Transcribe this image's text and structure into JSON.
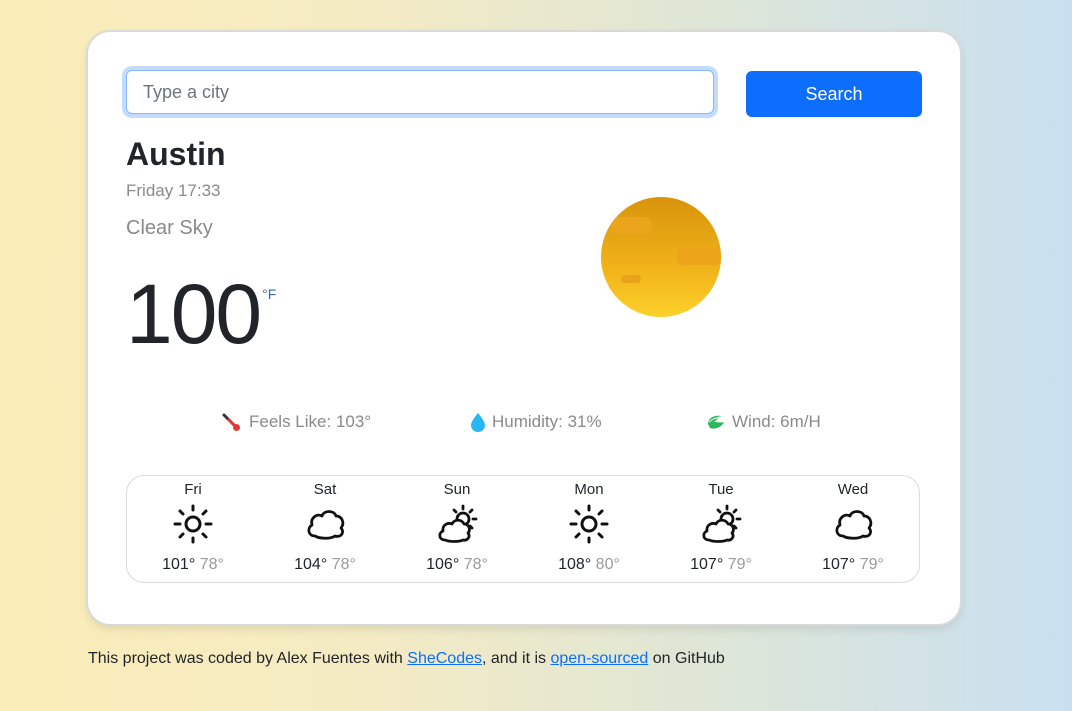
{
  "search": {
    "placeholder": "Type a city",
    "button_label": "Search"
  },
  "current": {
    "city": "Austin",
    "datetime": "Friday 17:33",
    "description": "Clear Sky",
    "temperature": "100",
    "unit": "°F",
    "icon": "clear-sky-sun-icon"
  },
  "stats": {
    "feels_like": {
      "label": "Feels Like: 103°",
      "icon": "thermometer-icon"
    },
    "humidity": {
      "label": "Humidity: 31%",
      "icon": "droplet-icon"
    },
    "wind": {
      "label": "Wind: 6m/H",
      "icon": "leaf-wind-icon"
    }
  },
  "forecast": [
    {
      "day": "Fri",
      "max": "101°",
      "min": "78°",
      "icon": "sun-icon"
    },
    {
      "day": "Sat",
      "max": "104°",
      "min": "78°",
      "icon": "cloud-icon"
    },
    {
      "day": "Sun",
      "max": "106°",
      "min": "78°",
      "icon": "partly-cloudy-icon"
    },
    {
      "day": "Mon",
      "max": "108°",
      "min": "80°",
      "icon": "sun-icon"
    },
    {
      "day": "Tue",
      "max": "107°",
      "min": "79°",
      "icon": "partly-cloudy-icon"
    },
    {
      "day": "Wed",
      "max": "107°",
      "min": "79°",
      "icon": "cloud-icon"
    }
  ],
  "footer": {
    "text_before": "This project was coded by Alex Fuentes with ",
    "link1": "SheCodes",
    "text_middle": ", and it is ",
    "link2": "open-sourced",
    "text_after": " on GitHub"
  },
  "colors": {
    "accent": "#0d6efd",
    "sun_top": "#d8940c",
    "sun_bottom": "#fcd12a"
  }
}
